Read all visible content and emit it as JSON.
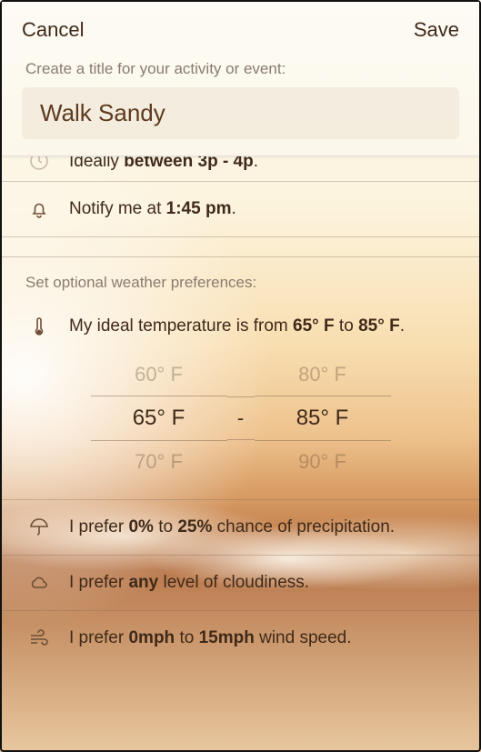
{
  "nav": {
    "cancel": "Cancel",
    "save": "Save"
  },
  "title_prompt": "Create a title for your activity or event:",
  "title_value": "Walk Sandy",
  "time_row": {
    "prefix": "Ideally ",
    "bold": "between 3p - 4p",
    "suffix": "."
  },
  "notify_row": {
    "prefix": "Notify me at ",
    "bold": "1:45 pm",
    "suffix": "."
  },
  "prefs_label": "Set optional weather preferences:",
  "temp_row": {
    "t1": "My ideal temperature is from ",
    "b1": "65° F",
    "t2": " to ",
    "b2": "85° F",
    "t3": "."
  },
  "picker": {
    "low_prev": "60° F",
    "low_sel": "65° F",
    "low_next": "70° F",
    "high_prev": "80° F",
    "high_sel": "85° F",
    "high_next": "90° F",
    "dash": "-"
  },
  "precip_row": {
    "t1": "I prefer ",
    "b1": "0%",
    "t2": " to ",
    "b2": "25%",
    "t3": " chance of precipitation."
  },
  "cloud_row": {
    "t1": "I prefer ",
    "b1": "any",
    "t2": " level of cloudiness."
  },
  "wind_row": {
    "t1": "I prefer ",
    "b1": "0mph",
    "t2": " to ",
    "b2": "15mph",
    "t3": " wind speed."
  }
}
